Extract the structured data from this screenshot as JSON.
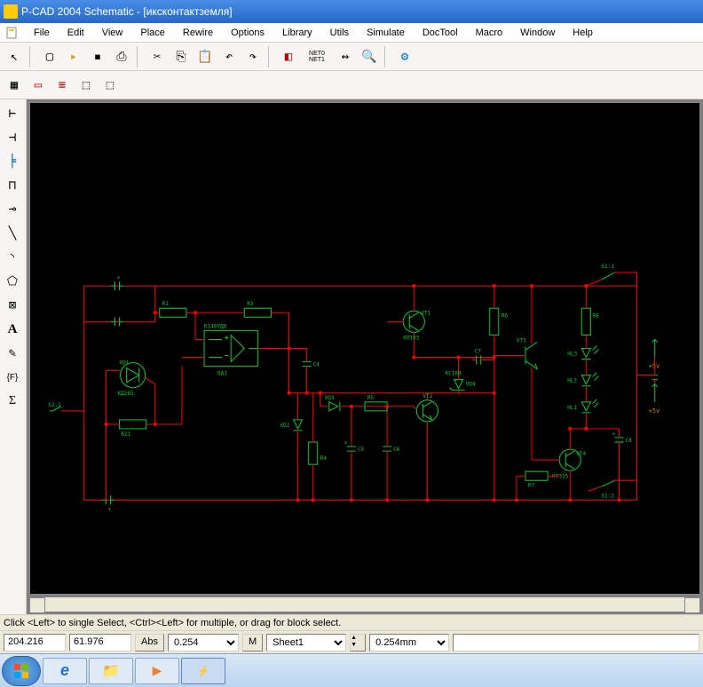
{
  "title": "P-CAD 2004 Schematic - [иксконтактземля]",
  "menu": {
    "items": [
      "File",
      "Edit",
      "View",
      "Place",
      "Rewire",
      "Options",
      "Library",
      "Utils",
      "Simulate",
      "DocTool",
      "Macro",
      "Window",
      "Help"
    ]
  },
  "toolbar1": {
    "buttons": [
      {
        "name": "select-arrow-tool",
        "glyph": "↖"
      },
      {
        "sep": true
      },
      {
        "name": "new-file-button",
        "glyph": "□"
      },
      {
        "name": "open-file-button",
        "glyph": "📂"
      },
      {
        "name": "save-file-button",
        "glyph": "💾"
      },
      {
        "name": "print-button",
        "glyph": "🖨"
      },
      {
        "sep": true
      },
      {
        "name": "cut-button",
        "glyph": "✂"
      },
      {
        "name": "copy-button",
        "glyph": "⎘"
      },
      {
        "name": "paste-button",
        "glyph": "📋"
      },
      {
        "name": "undo-button",
        "glyph": "↶"
      },
      {
        "name": "redo-button",
        "glyph": "↷"
      },
      {
        "sep": true
      },
      {
        "name": "record-tool",
        "glyph": "◧"
      },
      {
        "name": "netlist-tool",
        "glyph": "NET0\nNET1",
        "small": true
      },
      {
        "name": "measure-tool",
        "glyph": "📏"
      },
      {
        "name": "zoom-tool",
        "glyph": "🔍"
      },
      {
        "sep": true
      },
      {
        "name": "component-tool",
        "glyph": "⚙"
      }
    ]
  },
  "toolbar2": {
    "buttons": [
      {
        "name": "grid-button",
        "glyph": "▦"
      },
      {
        "name": "select-rect-button",
        "glyph": "▭"
      },
      {
        "name": "list-button",
        "glyph": "≡"
      },
      {
        "name": "hierarchy-up-button",
        "glyph": "⇱"
      },
      {
        "name": "hierarchy-down-button",
        "glyph": "⇲"
      }
    ]
  },
  "left_toolbar": {
    "buttons": [
      {
        "name": "place-part-tool",
        "glyph": "⊢"
      },
      {
        "name": "place-wire-tool",
        "glyph": "⊣"
      },
      {
        "name": "place-bus-tool",
        "glyph": "╞",
        "color": "#cc0000"
      },
      {
        "name": "place-port-tool",
        "glyph": "⊓"
      },
      {
        "name": "place-pin-tool",
        "glyph": "⊸"
      },
      {
        "name": "place-line-tool",
        "glyph": "╲"
      },
      {
        "name": "place-arc-tool",
        "glyph": "◝"
      },
      {
        "name": "place-polygon-tool",
        "glyph": "⬠"
      },
      {
        "name": "place-ref-tool",
        "glyph": "⊠"
      },
      {
        "name": "place-text-tool",
        "glyph": "A",
        "bold": true
      },
      {
        "name": "place-attribute-tool",
        "glyph": "✎"
      },
      {
        "name": "place-field-tool",
        "glyph": "{F}"
      },
      {
        "name": "place-ieee-tool",
        "glyph": "Σ"
      }
    ]
  },
  "status": {
    "hint": "Click <Left> to single Select, <Ctrl><Left> for multiple, or drag for block select."
  },
  "bottom": {
    "x": "204.216",
    "y": "61.976",
    "abs_button": "Abs",
    "grid": "0.254",
    "m_button": "M",
    "sheet": "Sheet1",
    "units": "0.254mm"
  },
  "schematic_labels": {
    "vd1": "VD1",
    "kd265": "КД265",
    "r1": "R1",
    "r3": "R3",
    "r5": "R5",
    "r6": "R6",
    "r8": "R8",
    "r7": "R7",
    "r21": "R21",
    "r4": "R4",
    "c4": "C4",
    "c5": "C5",
    "c6": "C6",
    "c7": "C7",
    "c8": "C8",
    "vt1": "VT1",
    "vt2": "VT2",
    "vt3": "VT3",
    "vt4": "VT4",
    "vd3": "VD3",
    "vd4": "VD4",
    "vd2": "VD2",
    "kp103": "КП103",
    "kt315": "КТ315",
    "kc168": "КС168",
    "da1": "DA1",
    "k140ud6": "К140УД6",
    "hl1": "HL1",
    "hl2": "HL2",
    "hl3": "HL3",
    "s11": "S1:1",
    "s12": "S1:2",
    "s21": "S2:1",
    "p5v": "+5v"
  }
}
